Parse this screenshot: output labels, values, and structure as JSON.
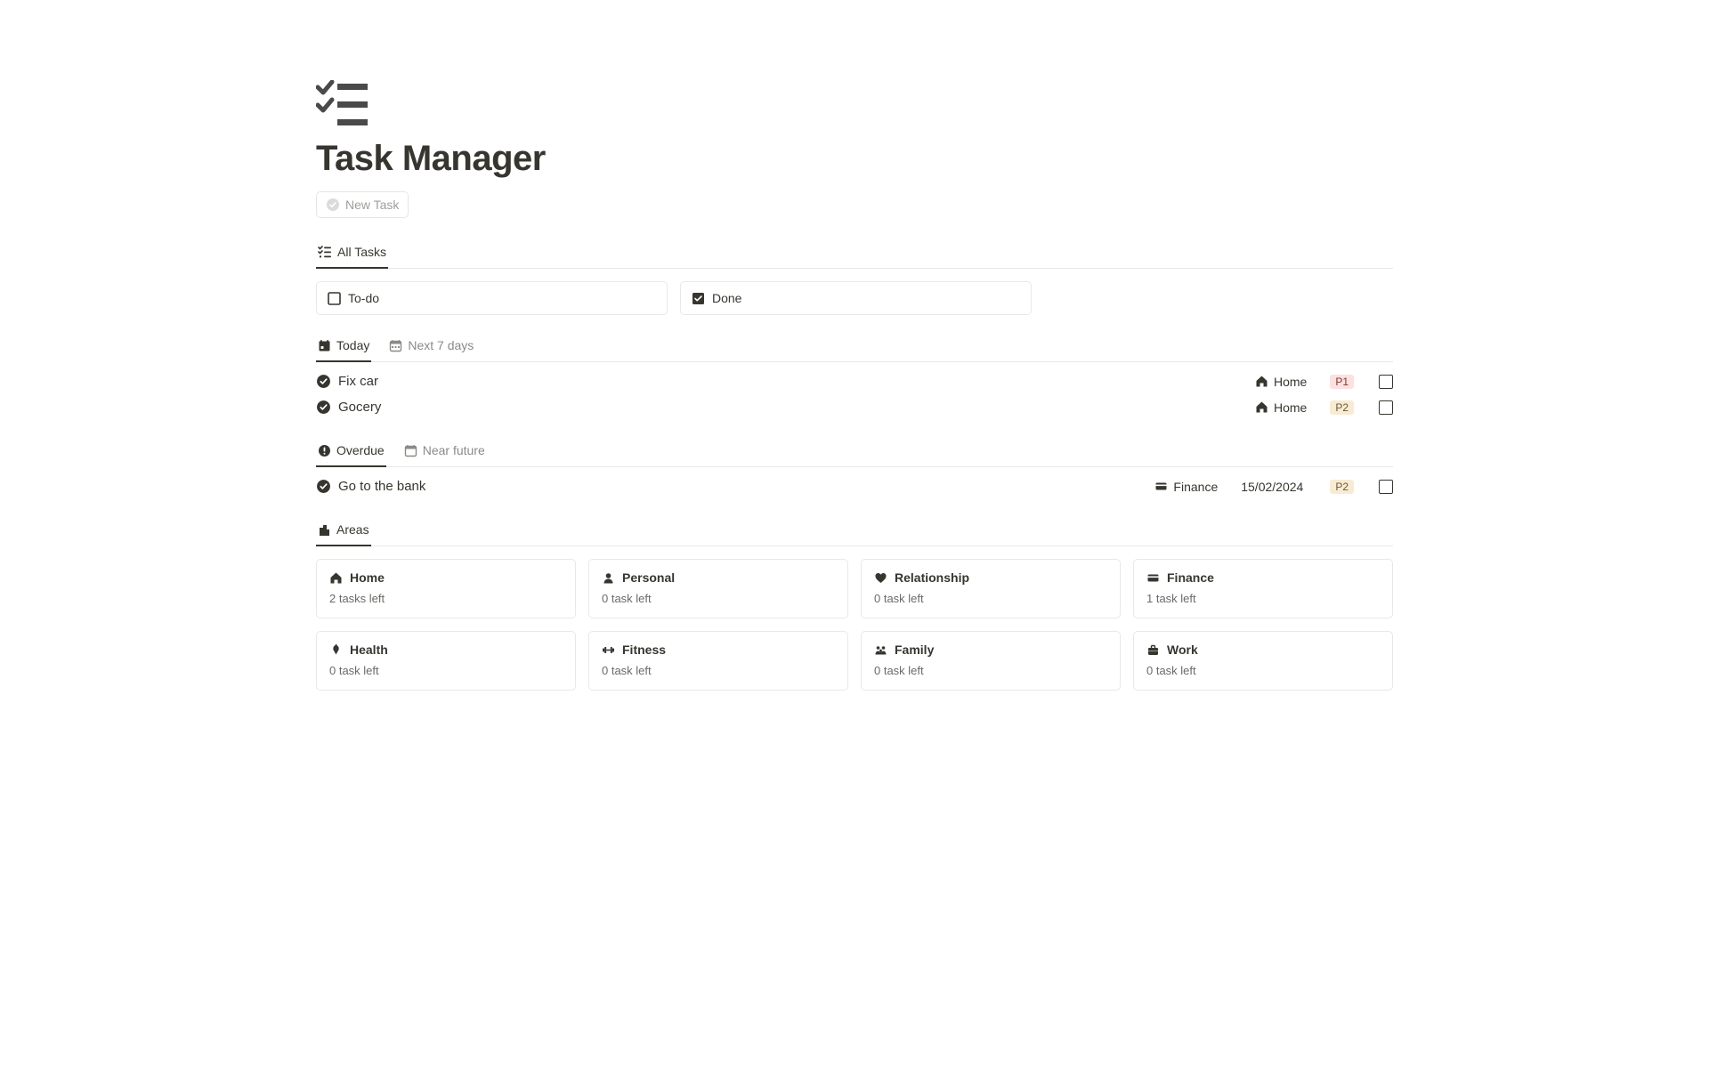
{
  "header": {
    "title": "Task Manager",
    "new_task_label": "New Task"
  },
  "tabs_main": {
    "all_tasks": "All Tasks"
  },
  "status": {
    "todo": "To-do",
    "done": "Done"
  },
  "tabs_today": {
    "today": "Today",
    "next7": "Next 7 days"
  },
  "today_tasks": [
    {
      "name": "Fix car",
      "area_icon": "home",
      "area": "Home",
      "priority": "P1",
      "priority_class": "p1"
    },
    {
      "name": "Gocery",
      "area_icon": "home",
      "area": "Home",
      "priority": "P2",
      "priority_class": "p2"
    }
  ],
  "tabs_overdue": {
    "overdue": "Overdue",
    "near_future": "Near future"
  },
  "overdue_tasks": [
    {
      "name": "Go to the bank",
      "area_icon": "finance",
      "area": "Finance",
      "date": "15/02/2024",
      "priority": "P2",
      "priority_class": "p2"
    }
  ],
  "tabs_areas": {
    "areas": "Areas"
  },
  "areas": [
    {
      "icon": "home",
      "title": "Home",
      "sub": "2 tasks left"
    },
    {
      "icon": "personal",
      "title": "Personal",
      "sub": "0 task left"
    },
    {
      "icon": "relationship",
      "title": "Relationship",
      "sub": "0 task left"
    },
    {
      "icon": "finance",
      "title": "Finance",
      "sub": "1 task left"
    },
    {
      "icon": "health",
      "title": "Health",
      "sub": "0 task left"
    },
    {
      "icon": "fitness",
      "title": "Fitness",
      "sub": "0 task left"
    },
    {
      "icon": "family",
      "title": "Family",
      "sub": "0 task left"
    },
    {
      "icon": "work",
      "title": "Work",
      "sub": "0 task left"
    }
  ]
}
